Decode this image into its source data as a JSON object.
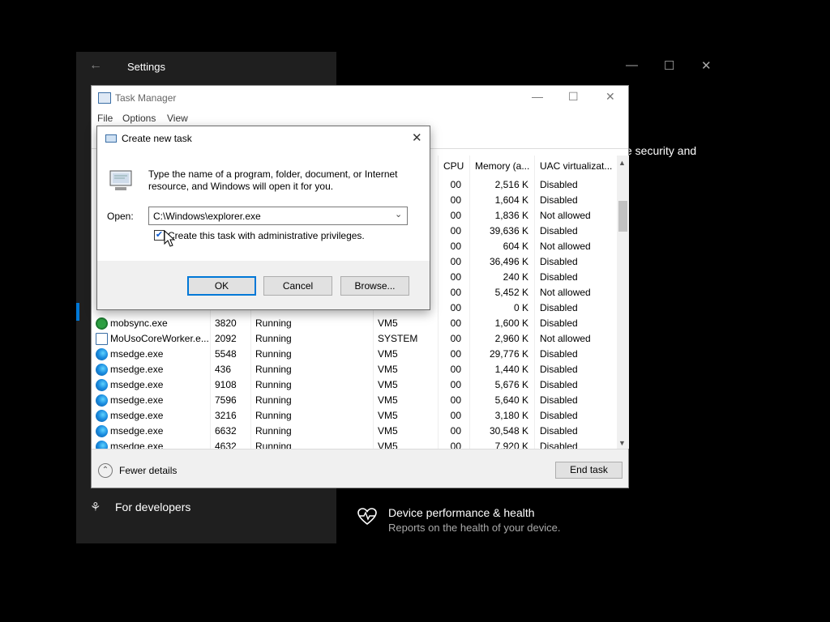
{
  "settings": {
    "title": "Settings",
    "back_icon": "back-arrow-icon",
    "partial_text": "e security and",
    "nav": [
      {
        "icon": "developer-tools-icon",
        "label": "For developers"
      }
    ],
    "device_card": {
      "icon": "heart-pulse-icon",
      "title": "Device performance & health",
      "subtitle": "Reports on the health of your device."
    }
  },
  "taskmanager": {
    "title": "Task Manager",
    "menu": [
      "File",
      "Options",
      "View"
    ],
    "columns": {
      "cpu": "CPU",
      "memory": "Memory (a...",
      "uac": "UAC virtualizat..."
    },
    "rows": [
      {
        "name": "",
        "pid": "",
        "status": "",
        "user": "",
        "cpu": "00",
        "mem": "2,516 K",
        "uac": "Disabled",
        "icon": "none"
      },
      {
        "name": "",
        "pid": "",
        "status": "",
        "user": "",
        "cpu": "00",
        "mem": "1,604 K",
        "uac": "Disabled",
        "icon": "none"
      },
      {
        "name": "",
        "pid": "",
        "status": "",
        "user": "",
        "cpu": "00",
        "mem": "1,836 K",
        "uac": "Not allowed",
        "icon": "none"
      },
      {
        "name": "",
        "pid": "",
        "status": "",
        "user": "",
        "cpu": "00",
        "mem": "39,636 K",
        "uac": "Disabled",
        "icon": "none"
      },
      {
        "name": "",
        "pid": "",
        "status": "",
        "user": "",
        "cpu": "00",
        "mem": "604 K",
        "uac": "Not allowed",
        "icon": "none"
      },
      {
        "name": "",
        "pid": "",
        "status": "",
        "user": "",
        "cpu": "00",
        "mem": "36,496 K",
        "uac": "Disabled",
        "icon": "none"
      },
      {
        "name": "",
        "pid": "",
        "status": "",
        "user": "",
        "cpu": "00",
        "mem": "240 K",
        "uac": "Disabled",
        "icon": "none"
      },
      {
        "name": "",
        "pid": "",
        "status": "",
        "user": "",
        "cpu": "00",
        "mem": "5,452 K",
        "uac": "Not allowed",
        "icon": "none"
      },
      {
        "name": "",
        "pid": "",
        "status": "",
        "user": "",
        "cpu": "00",
        "mem": "0 K",
        "uac": "Disabled",
        "icon": "none"
      },
      {
        "name": "mobsync.exe",
        "pid": "3820",
        "status": "Running",
        "user": "VM5",
        "cpu": "00",
        "mem": "1,600 K",
        "uac": "Disabled",
        "icon": "sync"
      },
      {
        "name": "MoUsoCoreWorker.e...",
        "pid": "2092",
        "status": "Running",
        "user": "SYSTEM",
        "cpu": "00",
        "mem": "2,960 K",
        "uac": "Not allowed",
        "icon": "win"
      },
      {
        "name": "msedge.exe",
        "pid": "5548",
        "status": "Running",
        "user": "VM5",
        "cpu": "00",
        "mem": "29,776 K",
        "uac": "Disabled",
        "icon": "edge"
      },
      {
        "name": "msedge.exe",
        "pid": "436",
        "status": "Running",
        "user": "VM5",
        "cpu": "00",
        "mem": "1,440 K",
        "uac": "Disabled",
        "icon": "edge"
      },
      {
        "name": "msedge.exe",
        "pid": "9108",
        "status": "Running",
        "user": "VM5",
        "cpu": "00",
        "mem": "5,676 K",
        "uac": "Disabled",
        "icon": "edge"
      },
      {
        "name": "msedge.exe",
        "pid": "7596",
        "status": "Running",
        "user": "VM5",
        "cpu": "00",
        "mem": "5,640 K",
        "uac": "Disabled",
        "icon": "edge"
      },
      {
        "name": "msedge.exe",
        "pid": "3216",
        "status": "Running",
        "user": "VM5",
        "cpu": "00",
        "mem": "3,180 K",
        "uac": "Disabled",
        "icon": "edge"
      },
      {
        "name": "msedge.exe",
        "pid": "6632",
        "status": "Running",
        "user": "VM5",
        "cpu": "00",
        "mem": "30,548 K",
        "uac": "Disabled",
        "icon": "edge"
      },
      {
        "name": "msedge.exe",
        "pid": "4632",
        "status": "Running",
        "user": "VM5",
        "cpu": "00",
        "mem": "7,920 K",
        "uac": "Disabled",
        "icon": "edge"
      }
    ],
    "footer": {
      "fewer_details": "Fewer details",
      "end_task": "End task"
    }
  },
  "dialog": {
    "title": "Create new task",
    "description": "Type the name of a program, folder, document, or Internet resource, and Windows will open it for you.",
    "open_label": "Open:",
    "open_value": "C:\\Windows\\explorer.exe",
    "admin_checkbox_label": "Create this task with administrative privileges.",
    "admin_checked": true,
    "ok": "OK",
    "cancel": "Cancel",
    "browse": "Browse..."
  },
  "colors": {
    "accent": "#0078d7",
    "settings_sidebar": "#1f1f1f"
  }
}
